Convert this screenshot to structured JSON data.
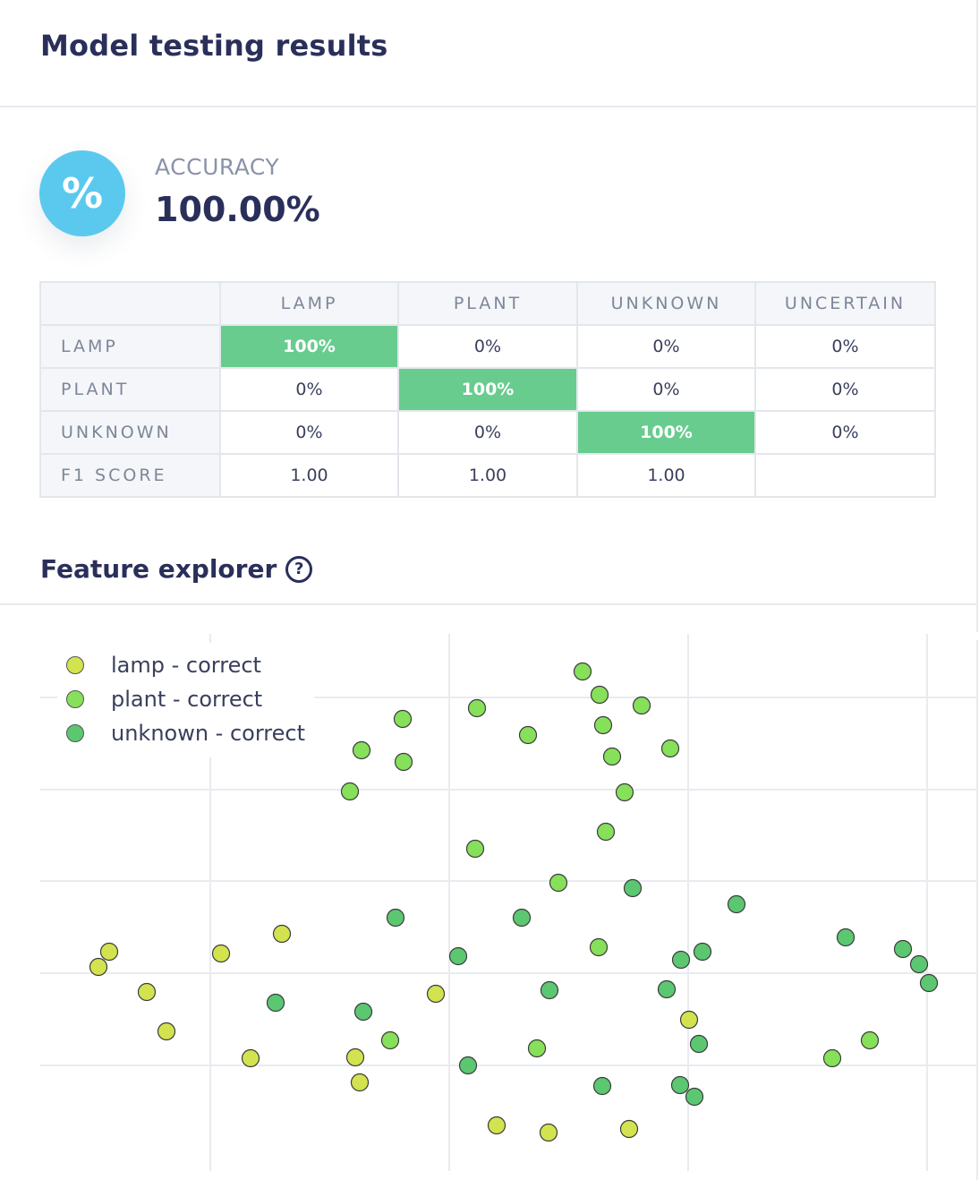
{
  "page": {
    "title": "Model testing results"
  },
  "accuracy": {
    "icon": "percent-icon",
    "icon_glyph": "%",
    "label": "ACCURACY",
    "value": "100.00%",
    "color": "#5bc9ee"
  },
  "confusion_matrix": {
    "columns": [
      "LAMP",
      "PLANT",
      "UNKNOWN",
      "UNCERTAIN"
    ],
    "rows": [
      {
        "label": "LAMP",
        "cells": [
          "100%",
          "0%",
          "0%",
          "0%"
        ]
      },
      {
        "label": "PLANT",
        "cells": [
          "0%",
          "100%",
          "0%",
          "0%"
        ]
      },
      {
        "label": "UNKNOWN",
        "cells": [
          "0%",
          "0%",
          "100%",
          "0%"
        ]
      }
    ],
    "f1": {
      "label": "F1 SCORE",
      "cells": [
        "1.00",
        "1.00",
        "1.00",
        ""
      ]
    },
    "highlight_color": "#68cc8e"
  },
  "feature_explorer": {
    "title": "Feature explorer",
    "help_icon": "question-circle-icon",
    "help_glyph": "?"
  },
  "chart_data": {
    "type": "scatter",
    "title": "",
    "xlabel": "",
    "ylabel": "",
    "grid": true,
    "legend_position": "top-left",
    "xlim": [
      0,
      1094
    ],
    "ylim": [
      0,
      642
    ],
    "x_grid": [
      235,
      502,
      769,
      1036
    ],
    "y_grid": [
      128,
      231,
      334,
      436,
      539
    ],
    "series": [
      {
        "name": "lamp - correct",
        "color": "#d3e34f",
        "points": [
          [
            122,
            255
          ],
          [
            110,
            238
          ],
          [
            164,
            210
          ],
          [
            186,
            166
          ],
          [
            247,
            253
          ],
          [
            315,
            275
          ],
          [
            280,
            136
          ],
          [
            397,
            137
          ],
          [
            402,
            109
          ],
          [
            487,
            208
          ],
          [
            770,
            179
          ],
          [
            555,
            61
          ],
          [
            613,
            53
          ],
          [
            703,
            57
          ]
        ]
      },
      {
        "name": "plant - correct",
        "color": "#86e05a",
        "points": [
          [
            651,
            568
          ],
          [
            670,
            542
          ],
          [
            717,
            530
          ],
          [
            533,
            527
          ],
          [
            450,
            515
          ],
          [
            674,
            508
          ],
          [
            590,
            497
          ],
          [
            404,
            480
          ],
          [
            451,
            467
          ],
          [
            684,
            473
          ],
          [
            749,
            482
          ],
          [
            391,
            434
          ],
          [
            698,
            433
          ],
          [
            677,
            389
          ],
          [
            531,
            370
          ],
          [
            624,
            332
          ],
          [
            669,
            260
          ],
          [
            436,
            156
          ],
          [
            600,
            147
          ],
          [
            930,
            136
          ],
          [
            972,
            156
          ]
        ]
      },
      {
        "name": "unknown - correct",
        "color": "#5cc771",
        "points": [
          [
            707,
            326
          ],
          [
            823,
            308
          ],
          [
            442,
            293
          ],
          [
            583,
            293
          ],
          [
            512,
            250
          ],
          [
            785,
            255
          ],
          [
            761,
            246
          ],
          [
            945,
            271
          ],
          [
            1009,
            258
          ],
          [
            1027,
            241
          ],
          [
            1038,
            220
          ],
          [
            614,
            212
          ],
          [
            745,
            213
          ],
          [
            308,
            198
          ],
          [
            406,
            188
          ],
          [
            781,
            152
          ],
          [
            523,
            128
          ],
          [
            673,
            105
          ],
          [
            760,
            106
          ],
          [
            776,
            93
          ]
        ]
      }
    ]
  }
}
